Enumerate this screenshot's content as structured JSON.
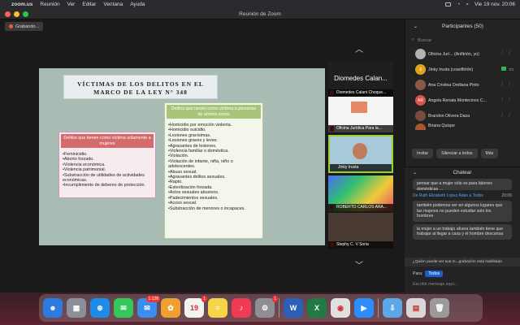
{
  "menubar": {
    "app": "zoom.us",
    "menus": [
      "Reunión",
      "Ver",
      "Editar",
      "Ventana",
      "Ayuda"
    ],
    "clock": "Vie 19 nov.  20:06"
  },
  "window": {
    "title": "Reunión de Zoom"
  },
  "recording": {
    "label": "Grabando..."
  },
  "slide": {
    "title": "VÍCTIMAS DE LOS DELITOS EN EL MARCO DE LA LEY N° 348",
    "left_box": {
      "header": "Delitos que tienen como víctima solamente a mujeres",
      "items": [
        "Feminicidio.",
        "Aborto forzado.",
        "Violencia económica.",
        "Violencia patrimonial.",
        "Substracción de utilidades de actividades económicas.",
        "Incumplimiento de deberes de protección."
      ]
    },
    "right_box": {
      "header": "Delitos que tienen como víctima a personas de ambos sexos",
      "items": [
        "Homicidio por emoción violenta.",
        "Homicidio suicidio.",
        "Lesiones gravísimas.",
        "Lesiones graves y leves.",
        "Agravantes de lesiones.",
        "Violencia familiar o doméstica.",
        "Violación.",
        "Violación de infante, niña, niño o adolescentes.",
        "Abuso sexual.",
        "Agravantes delitos sexuales.",
        "Rapto.",
        "Esterilización forzada.",
        "Actos sexuales abusivos.",
        "Padecimientos sexuales.",
        "Acoso sexual.",
        "Substracción de menores o incapaces."
      ]
    }
  },
  "thumbnails": [
    {
      "name": "Diomedes Calan..."
    },
    {
      "name": "Diomedes Calani Choque..."
    },
    {
      "name": "Oficina Jurídica Para la..."
    },
    {
      "name": "Jinky Irusta"
    },
    {
      "name": "ROBERTO CARLOS ARA..."
    },
    {
      "name": "Stephy C. V Soria"
    }
  ],
  "participants": {
    "title": "Participantes (50)",
    "search_placeholder": "Buscar",
    "list": [
      {
        "name": "Oficina Jurí... (Anfitrión, yo)",
        "initials": "",
        "color": "#b3b3b3"
      },
      {
        "name": "Jinky Irusta (coanfitrión)",
        "initials": "JI",
        "color": "#e3a21a"
      },
      {
        "name": "Ana Cristina Orellana Pinto",
        "initials": "",
        "color": "#8a5a44"
      },
      {
        "name": "Angela Renata Montecinos C...",
        "initials": "AR",
        "color": "#d9534f"
      },
      {
        "name": "Brandon Olivera Daza",
        "initials": "",
        "color": "#7a4a3a"
      },
      {
        "name": "Briana Quispe",
        "initials": "",
        "color": "#aa5533"
      }
    ],
    "buttons": [
      "Invitar",
      "Silenciar a todos",
      "Más"
    ]
  },
  "chat": {
    "title": "Chatear",
    "messages": [
      {
        "from": "",
        "time": "",
        "text": "pensar que a mujer sólo es para labores domésticas ..."
      },
      {
        "from": "De Ruth Elizabeth Lopez Adan a Todos",
        "time": "20:06",
        "text": "también podemos ver en algunos lugares que las mujeres no pueden estudiar solo los hombres"
      },
      {
        "from": "",
        "time": "",
        "text": "la mujer a un trabajo afuera también tiene que trabajar al llegar a casa y el hombre descansa"
      }
    ],
    "notice": "¿Quién puede ver sus m...grabación está habilitada",
    "to_label": "Para:",
    "to_value": "Todos",
    "compose_placeholder": "Escribir mensaje aquí..."
  },
  "dock": {
    "apps": [
      {
        "name": "finder",
        "glyph": "☻",
        "color": "#2b7be0",
        "badge": ""
      },
      {
        "name": "launchpad",
        "glyph": "▦",
        "color": "#8a8f99",
        "badge": ""
      },
      {
        "name": "safari",
        "glyph": "⊕",
        "color": "#1f8be8",
        "badge": ""
      },
      {
        "name": "messages",
        "glyph": "✉",
        "color": "#35c759",
        "badge": ""
      },
      {
        "name": "mail",
        "glyph": "✉",
        "color": "#3a8ef0",
        "badge": "1.128"
      },
      {
        "name": "photos",
        "glyph": "✿",
        "color": "#f0a030",
        "badge": ""
      },
      {
        "name": "calendar",
        "glyph": "19",
        "color": "#f2f2f2",
        "badge": "1"
      },
      {
        "name": "notes",
        "glyph": "≡",
        "color": "#f5d547",
        "badge": ""
      },
      {
        "name": "music",
        "glyph": "♪",
        "color": "#f23a55",
        "badge": ""
      },
      {
        "name": "settings",
        "glyph": "⚙",
        "color": "#8e8e93",
        "badge": "1"
      },
      {
        "name": "word",
        "glyph": "W",
        "color": "#2b5fb8",
        "badge": ""
      },
      {
        "name": "excel",
        "glyph": "X",
        "color": "#1f7a43",
        "badge": ""
      },
      {
        "name": "chrome",
        "glyph": "◉",
        "color": "#e0e0e0",
        "badge": ""
      },
      {
        "name": "zoom",
        "glyph": "▶",
        "color": "#2d8cff",
        "badge": ""
      },
      {
        "name": "downloads",
        "glyph": "⇩",
        "color": "#5aa8e8",
        "badge": ""
      },
      {
        "name": "preview",
        "glyph": "▤",
        "color": "#d8d8d8",
        "badge": ""
      },
      {
        "name": "trash",
        "glyph": "🗑",
        "color": "#9a9a9a",
        "badge": ""
      }
    ]
  }
}
